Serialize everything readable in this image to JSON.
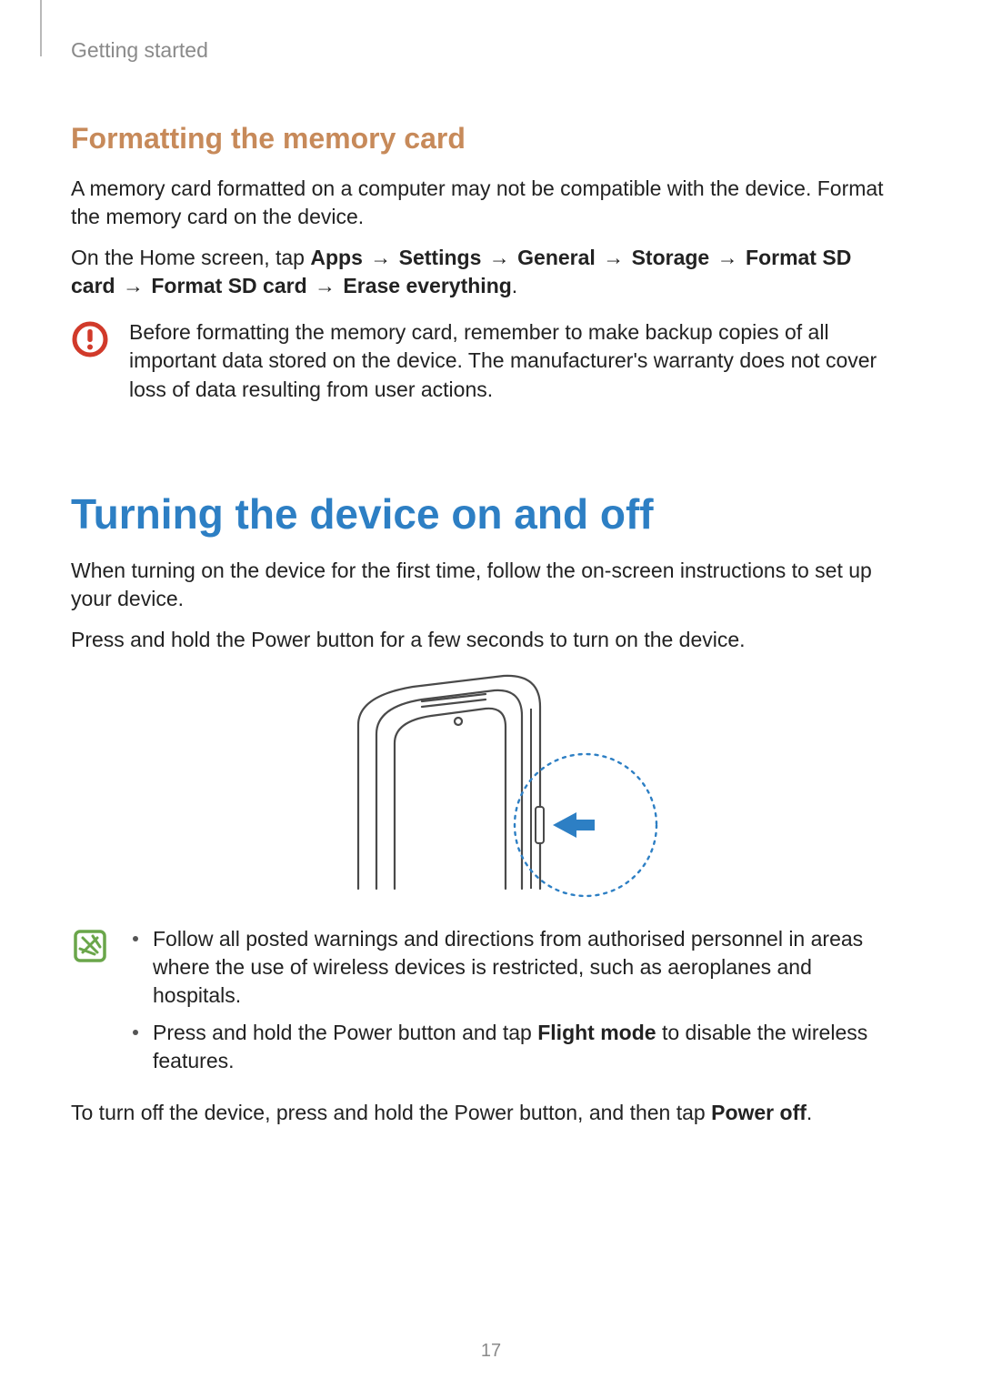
{
  "breadcrumb": "Getting started",
  "page_number": "17",
  "format_section": {
    "heading": "Formatting the memory card",
    "para1": "A memory card formatted on a computer may not be compatible with the device. Format the memory card on the device.",
    "path": {
      "prefix": "On the Home screen, tap ",
      "steps": [
        "Apps",
        "Settings",
        "General",
        "Storage",
        "Format SD card",
        "Format SD card",
        "Erase everything"
      ],
      "arrow": "→",
      "suffix": "."
    },
    "warning_icon": "caution-icon",
    "warning": "Before formatting the memory card, remember to make backup copies of all important data stored on the device. The manufacturer's warranty does not cover loss of data resulting from user actions."
  },
  "power_section": {
    "heading": "Turning the device on and off",
    "para1": "When turning on the device for the first time, follow the on-screen instructions to set up your device.",
    "para2": "Press and hold the Power button for a few seconds to turn on the device.",
    "note_icon": "note-icon",
    "bullets": {
      "b1_pre": "Follow all posted warnings and directions from authorised personnel in areas where the use of wireless devices is restricted, such as aeroplanes and hospitals.",
      "b2_pre": "Press and hold the Power button and tap ",
      "b2_bold": "Flight mode",
      "b2_post": " to disable the wireless features."
    },
    "closing_pre": "To turn off the device, press and hold the Power button, and then tap ",
    "closing_bold": "Power off",
    "closing_post": "."
  },
  "colors": {
    "accent_blue": "#2d7fc4",
    "accent_tan": "#c78a5a",
    "caution": "#d13a2a",
    "note": "#6aa64a"
  }
}
